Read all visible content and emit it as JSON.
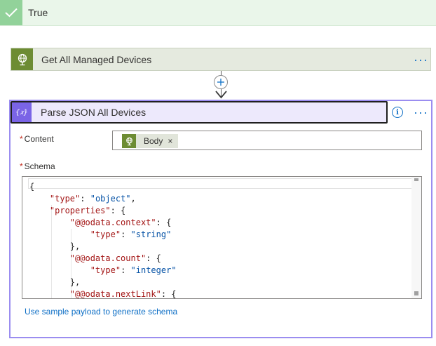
{
  "branch": {
    "label": "True"
  },
  "step_get_devices": {
    "title": "Get All Managed Devices",
    "more": "···"
  },
  "step_parse": {
    "title": "Parse JSON All Devices",
    "icon_text": "{𝑥}",
    "more": "···",
    "info": "i",
    "content_label": "Content",
    "content_token": "Body",
    "content_token_remove": "×",
    "schema_label": "Schema",
    "schema_lines": [
      "{",
      "    \"type\": \"object\",",
      "    \"properties\": {",
      "        \"@@odata.context\": {",
      "            \"type\": \"string\"",
      "        },",
      "        \"@@odata.count\": {",
      "            \"type\": \"integer\"",
      "        },",
      "        \"@@odata.nextLink\": {"
    ],
    "sample_link": "Use sample payload to generate schema"
  },
  "colors": {
    "accent_link": "#0e6fc6",
    "parse_accent": "#7a64e6",
    "connector_accent": "#6d8c33",
    "branch_bg": "#eaf6ea"
  },
  "icons": {
    "branch": "check-icon",
    "connector": "globe-icon",
    "parse": "variable-icon",
    "add": "plus-icon",
    "info": "info-icon"
  }
}
